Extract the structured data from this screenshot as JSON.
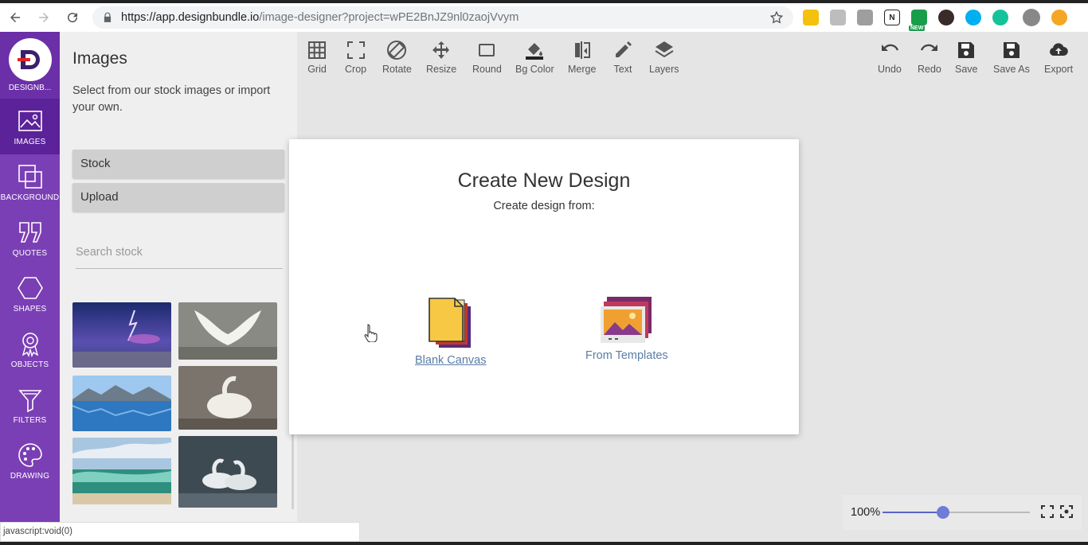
{
  "browser": {
    "url_base": "https://app.designbundle.io",
    "url_rest": "/image-designer?project=wPE2BnJZ9nl0zaojVvym",
    "extensions": [
      {
        "name": "sticky-note-extension-icon",
        "color": "#f4c20d"
      },
      {
        "name": "bookmark-extension-icon",
        "color": "#bdbdbd"
      },
      {
        "name": "code-extension-icon",
        "color": "#9e9e9e"
      },
      {
        "name": "notion-extension-icon",
        "color": "#ffffff",
        "text": "N"
      },
      {
        "name": "new-extension-icon",
        "color": "#1a9d4a",
        "badge": "NEW"
      },
      {
        "name": "k-extension-icon",
        "color": "#3a2a2a"
      },
      {
        "name": "skype-extension-icon",
        "color": "#00aff0"
      },
      {
        "name": "grammarly-extension-icon",
        "color": "#15c39a"
      },
      {
        "name": "alert-extension-icon",
        "color": "#f5a623"
      }
    ]
  },
  "rail": {
    "logo_text": "DESIGNB...",
    "items": [
      {
        "label": "IMAGES"
      },
      {
        "label": "BACKGROUND"
      },
      {
        "label": "QUOTES"
      },
      {
        "label": "SHAPES"
      },
      {
        "label": "OBJECTS"
      },
      {
        "label": "FILTERS"
      },
      {
        "label": "DRAWING"
      }
    ]
  },
  "panel": {
    "title": "Images",
    "description": "Select from our stock images or import your own.",
    "stock_label": "Stock",
    "upload_label": "Upload",
    "search_placeholder": "Search stock"
  },
  "toolbar": {
    "left": [
      {
        "label": "Grid",
        "icon": "grid-icon"
      },
      {
        "label": "Crop",
        "icon": "crop-icon"
      },
      {
        "label": "Rotate",
        "icon": "rotate-icon"
      },
      {
        "label": "Resize",
        "icon": "resize-icon"
      },
      {
        "label": "Round",
        "icon": "round-icon"
      },
      {
        "label": "Bg Color",
        "icon": "bg-color-icon"
      },
      {
        "label": "Merge",
        "icon": "merge-icon"
      },
      {
        "label": "Text",
        "icon": "text-icon"
      },
      {
        "label": "Layers",
        "icon": "layers-icon"
      }
    ],
    "right": [
      {
        "label": "Undo",
        "icon": "undo-icon"
      },
      {
        "label": "Redo",
        "icon": "redo-icon"
      },
      {
        "label": "Save",
        "icon": "save-icon"
      },
      {
        "label": "Save As",
        "icon": "save-as-icon"
      },
      {
        "label": "Export",
        "icon": "export-icon"
      }
    ]
  },
  "modal": {
    "title": "Create New Design",
    "subtitle": "Create design from:",
    "blank_label": "Blank Canvas",
    "templates_label": "From Templates"
  },
  "zoom": {
    "percent_label": "100%",
    "level": 0.41
  },
  "status_bar": "javascript:void(0)",
  "colors": {
    "brand_purple": "#7b3fb5",
    "accent_blue": "#5a65c4",
    "link_blue": "#5a7ca6"
  }
}
